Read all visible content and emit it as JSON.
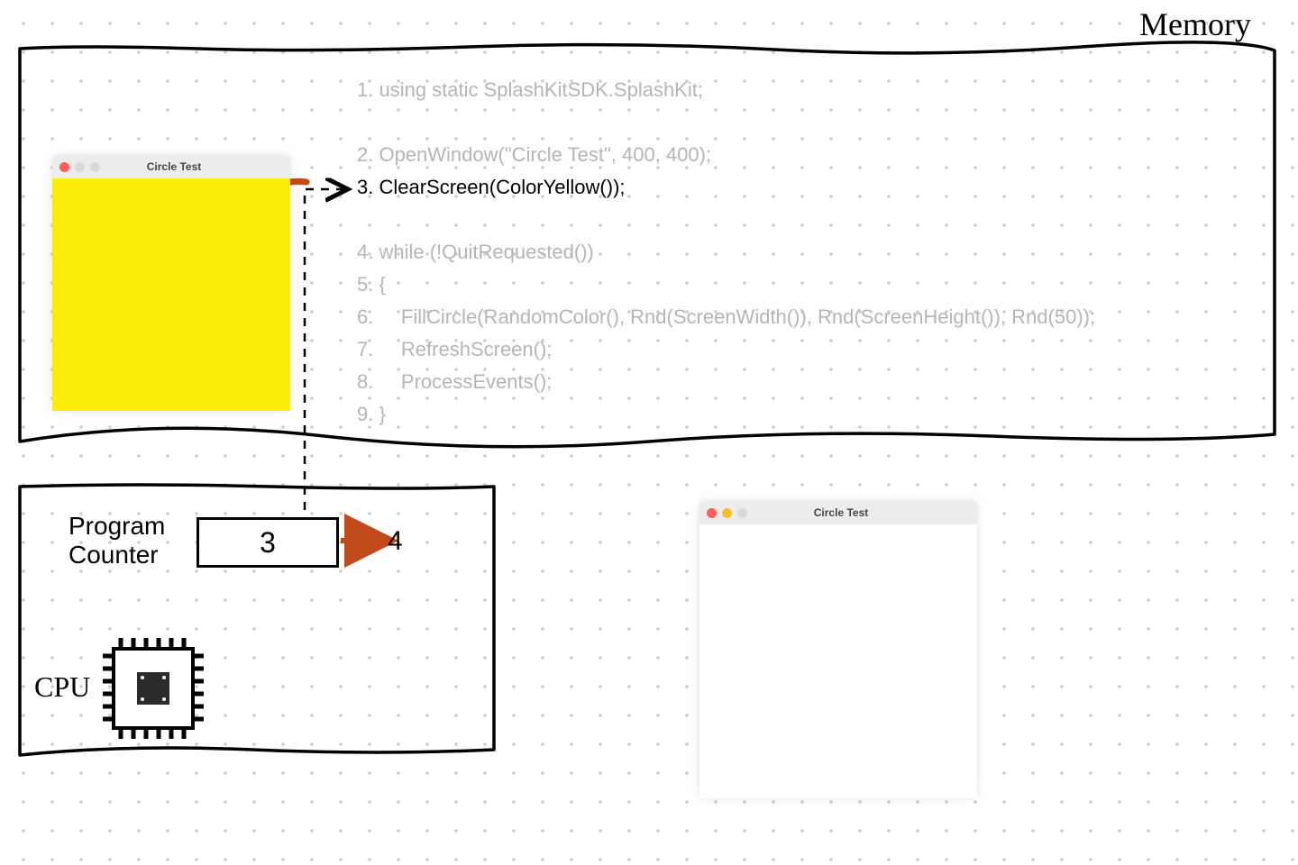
{
  "labels": {
    "memory": "Memory",
    "program_counter_l1": "Program",
    "program_counter_l2": "Counter",
    "cpu": "CPU",
    "pc_value": "3",
    "pc_next": "4"
  },
  "windows": {
    "main_title": "Circle Test",
    "output_title": "Circle Test"
  },
  "code": {
    "active_line": 3,
    "lines": [
      "1. using static SplashKitSDK.SplashKit;",
      "",
      "2. OpenWindow(\"Circle Test\", 400, 400);",
      "3. ClearScreen(ColorYellow());",
      "",
      "4. while (!QuitRequested())",
      "5. {",
      "6.     FillCircle(RandomColor(), Rnd(ScreenWidth()), Rnd(ScreenHeight()), Rnd(50));",
      "7.     RefreshScreen();",
      "8.     ProcessEvents();",
      "9. }"
    ]
  },
  "colors": {
    "arrow": "#c04a1a",
    "canvas_yellow": "#fcee0b"
  }
}
